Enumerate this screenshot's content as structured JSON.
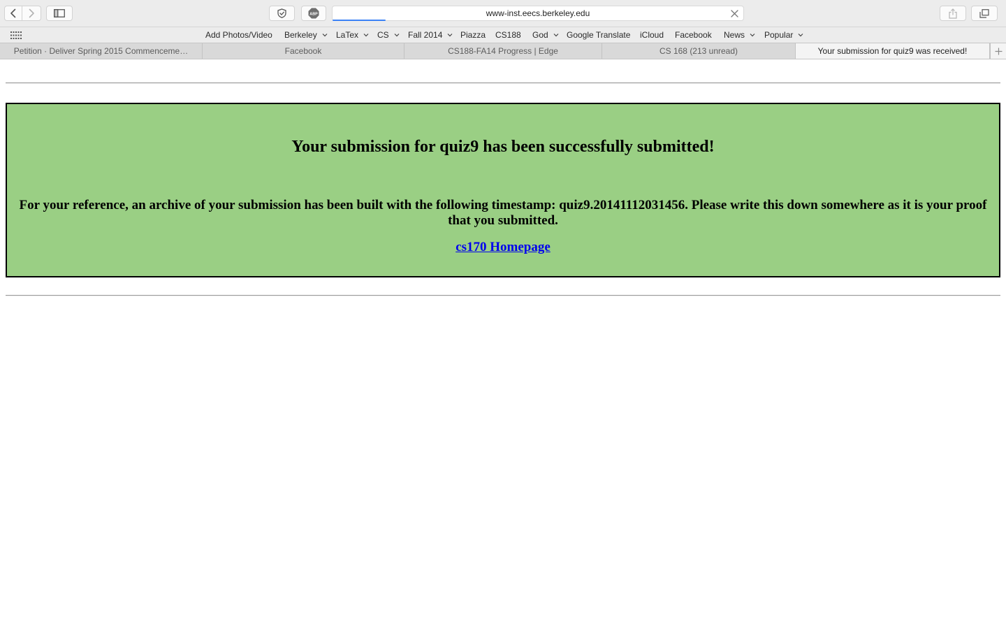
{
  "browser": {
    "address_url": "www-inst.eecs.berkeley.edu",
    "abp_label": "ABP",
    "bookmarks": [
      {
        "label": "Add Photos/Video",
        "menu": false
      },
      {
        "label": "Berkeley",
        "menu": true
      },
      {
        "label": "LaTex",
        "menu": true
      },
      {
        "label": "CS",
        "menu": true
      },
      {
        "label": "Fall 2014",
        "menu": true
      },
      {
        "label": "Piazza",
        "menu": false
      },
      {
        "label": "CS188",
        "menu": false
      },
      {
        "label": "God",
        "menu": true
      },
      {
        "label": "Google Translate",
        "menu": false
      },
      {
        "label": "iCloud",
        "menu": false
      },
      {
        "label": "Facebook",
        "menu": false
      },
      {
        "label": "News",
        "menu": true
      },
      {
        "label": "Popular",
        "menu": true
      }
    ],
    "tabs": [
      {
        "label": "Petition · Deliver Spring 2015 Commenceme…",
        "active": false
      },
      {
        "label": "Facebook",
        "active": false
      },
      {
        "label": "CS188-FA14 Progress | Edge",
        "active": false
      },
      {
        "label": "CS 168 (213 unread)",
        "active": false
      },
      {
        "label": "Your submission for quiz9 was received!",
        "active": true
      }
    ],
    "page_load_progress": 0.13,
    "accent_color": "#3b82f6"
  },
  "page": {
    "heading": "Your submission for quiz9 has been successfully submitted!",
    "reference_text": "For your reference, an archive of your submission has been built with the following timestamp: quiz9.20141112031456. Please write this down somewhere as it is your proof that you submitted.",
    "homepage_link": "cs170 Homepage",
    "box_color": "#9acf84",
    "link_color": "#0000ee"
  }
}
